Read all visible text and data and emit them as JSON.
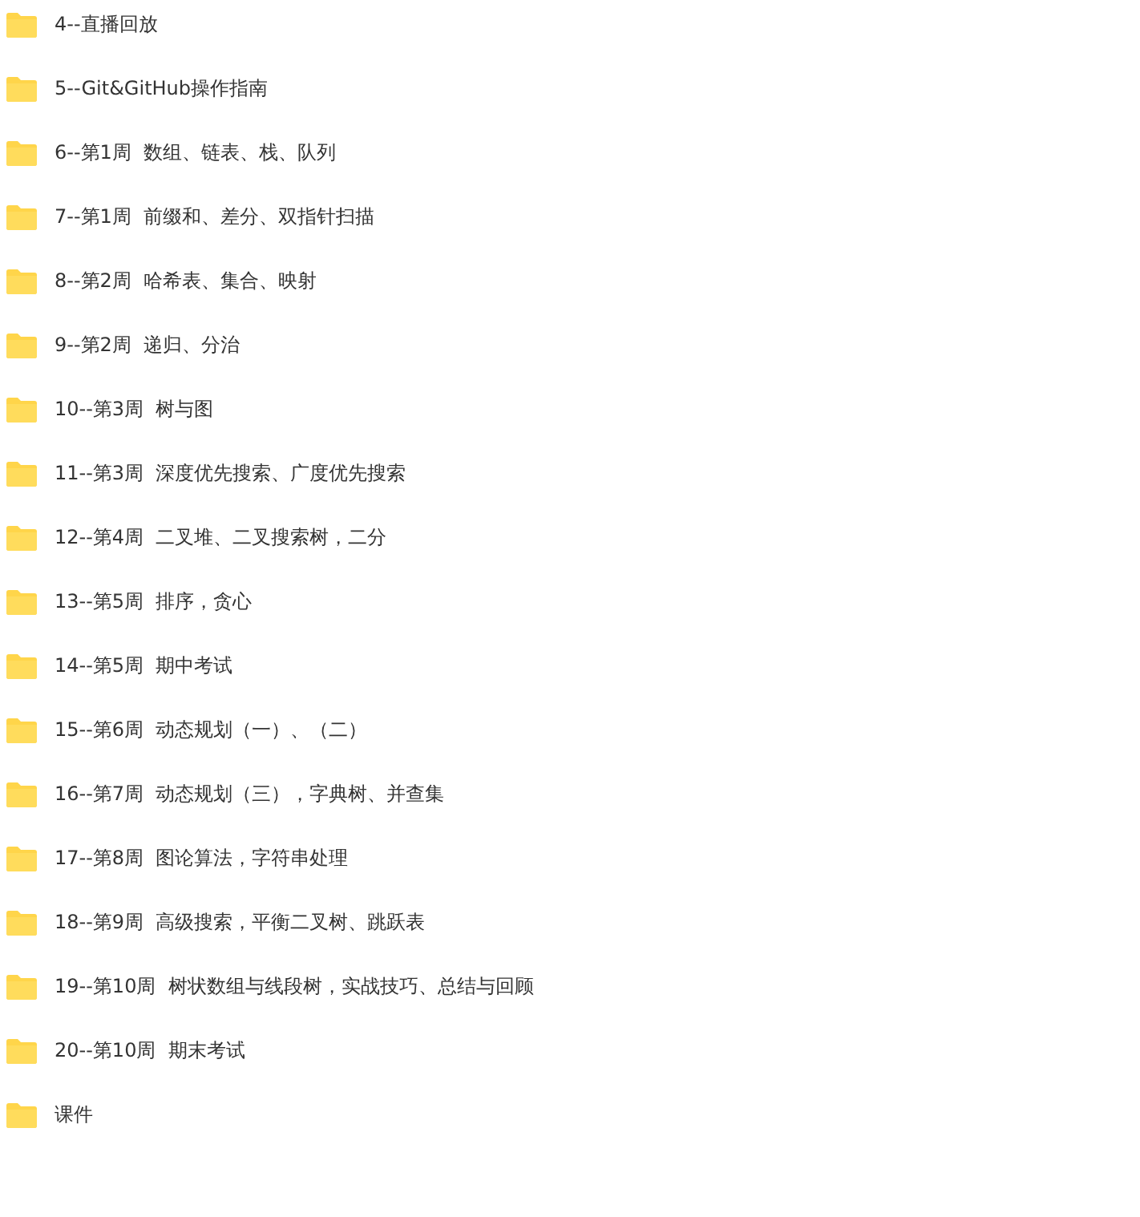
{
  "folders": [
    {
      "name": "4--直播回放"
    },
    {
      "name": "5--Git&GitHub操作指南"
    },
    {
      "name": "6--第1周  数组、链表、栈、队列"
    },
    {
      "name": "7--第1周  前缀和、差分、双指针扫描"
    },
    {
      "name": "8--第2周  哈希表、集合、映射"
    },
    {
      "name": "9--第2周  递归、分治"
    },
    {
      "name": "10--第3周  树与图"
    },
    {
      "name": "11--第3周  深度优先搜索、广度优先搜索"
    },
    {
      "name": "12--第4周  二叉堆、二叉搜索树，二分"
    },
    {
      "name": "13--第5周  排序，贪心"
    },
    {
      "name": "14--第5周  期中考试"
    },
    {
      "name": "15--第6周  动态规划（一）、（二）"
    },
    {
      "name": "16--第7周  动态规划（三），字典树、并查集"
    },
    {
      "name": "17--第8周  图论算法，字符串处理"
    },
    {
      "name": "18--第9周  高级搜索，平衡二叉树、跳跃表"
    },
    {
      "name": "19--第10周  树状数组与线段树，实战技巧、总结与回顾"
    },
    {
      "name": "20--第10周  期末考试"
    },
    {
      "name": "课件"
    }
  ]
}
